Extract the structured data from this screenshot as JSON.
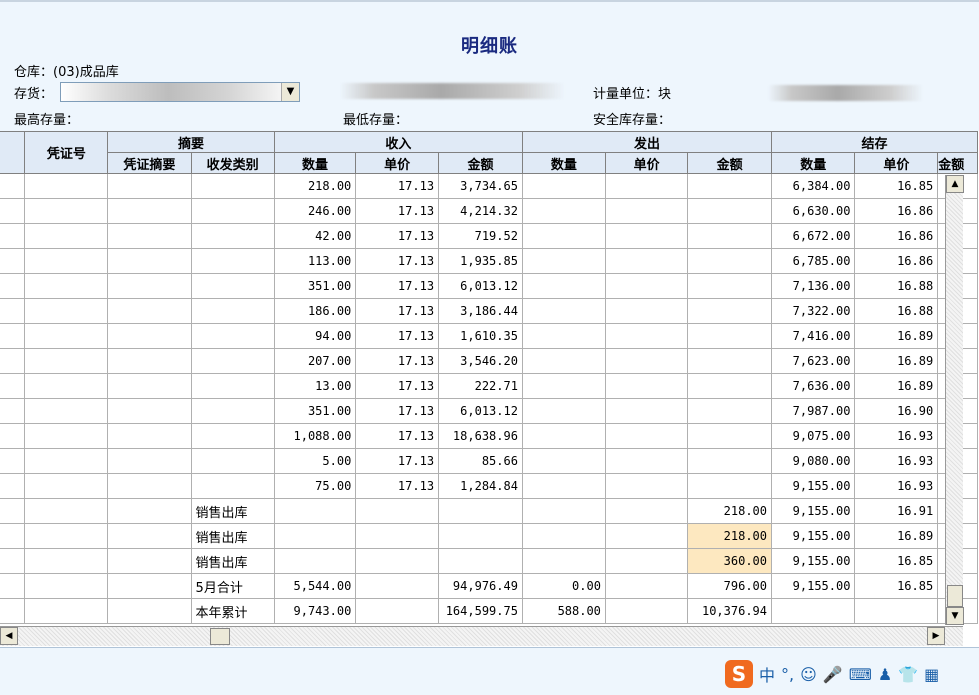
{
  "header": {
    "title": "明细账",
    "warehouse_label": "仓库：",
    "warehouse_value": "(03)成品库",
    "inventory_label": "存货：",
    "unit_label": "计量单位：",
    "unit_value": "块",
    "max_stock_label": "最高存量：",
    "min_stock_label": "最低存量：",
    "safety_stock_label": "安全库存量："
  },
  "columns": {
    "voucher_no": "凭证号",
    "summary": "摘要",
    "voucher_summary": "凭证摘要",
    "category": "收发类别",
    "income": "收入",
    "outgo": "发出",
    "balance": "结存",
    "qty": "数量",
    "price": "单价",
    "amount": "金额",
    "amount_cut": "金额"
  },
  "rows": [
    {
      "cat": "",
      "in_qty": "218.00",
      "in_price": "17.13",
      "in_amt": "3,734.65",
      "out_qty": "",
      "out_price": "",
      "out_amt": "",
      "bal_qty": "6,384.00",
      "bal_price": "16.85"
    },
    {
      "cat": "",
      "in_qty": "246.00",
      "in_price": "17.13",
      "in_amt": "4,214.32",
      "out_qty": "",
      "out_price": "",
      "out_amt": "",
      "bal_qty": "6,630.00",
      "bal_price": "16.86"
    },
    {
      "cat": "",
      "in_qty": "42.00",
      "in_price": "17.13",
      "in_amt": "719.52",
      "out_qty": "",
      "out_price": "",
      "out_amt": "",
      "bal_qty": "6,672.00",
      "bal_price": "16.86"
    },
    {
      "cat": "",
      "in_qty": "113.00",
      "in_price": "17.13",
      "in_amt": "1,935.85",
      "out_qty": "",
      "out_price": "",
      "out_amt": "",
      "bal_qty": "6,785.00",
      "bal_price": "16.86"
    },
    {
      "cat": "",
      "in_qty": "351.00",
      "in_price": "17.13",
      "in_amt": "6,013.12",
      "out_qty": "",
      "out_price": "",
      "out_amt": "",
      "bal_qty": "7,136.00",
      "bal_price": "16.88"
    },
    {
      "cat": "",
      "in_qty": "186.00",
      "in_price": "17.13",
      "in_amt": "3,186.44",
      "out_qty": "",
      "out_price": "",
      "out_amt": "",
      "bal_qty": "7,322.00",
      "bal_price": "16.88"
    },
    {
      "cat": "",
      "in_qty": "94.00",
      "in_price": "17.13",
      "in_amt": "1,610.35",
      "out_qty": "",
      "out_price": "",
      "out_amt": "",
      "bal_qty": "7,416.00",
      "bal_price": "16.89"
    },
    {
      "cat": "",
      "in_qty": "207.00",
      "in_price": "17.13",
      "in_amt": "3,546.20",
      "out_qty": "",
      "out_price": "",
      "out_amt": "",
      "bal_qty": "7,623.00",
      "bal_price": "16.89"
    },
    {
      "cat": "",
      "in_qty": "13.00",
      "in_price": "17.13",
      "in_amt": "222.71",
      "out_qty": "",
      "out_price": "",
      "out_amt": "",
      "bal_qty": "7,636.00",
      "bal_price": "16.89"
    },
    {
      "cat": "",
      "in_qty": "351.00",
      "in_price": "17.13",
      "in_amt": "6,013.12",
      "out_qty": "",
      "out_price": "",
      "out_amt": "",
      "bal_qty": "7,987.00",
      "bal_price": "16.90"
    },
    {
      "cat": "",
      "in_qty": "1,088.00",
      "in_price": "17.13",
      "in_amt": "18,638.96",
      "out_qty": "",
      "out_price": "",
      "out_amt": "",
      "bal_qty": "9,075.00",
      "bal_price": "16.93"
    },
    {
      "cat": "",
      "in_qty": "5.00",
      "in_price": "17.13",
      "in_amt": "85.66",
      "out_qty": "",
      "out_price": "",
      "out_amt": "",
      "bal_qty": "9,080.00",
      "bal_price": "16.93"
    },
    {
      "cat": "",
      "in_qty": "75.00",
      "in_price": "17.13",
      "in_amt": "1,284.84",
      "out_qty": "",
      "out_price": "",
      "out_amt": "",
      "bal_qty": "9,155.00",
      "bal_price": "16.93"
    },
    {
      "cat": "销售出库",
      "in_qty": "",
      "in_price": "",
      "in_amt": "",
      "out_qty": "",
      "out_price": "",
      "out_amt": "218.00",
      "bal_qty": "9,155.00",
      "bal_price": "16.91",
      "style": "sel"
    },
    {
      "cat": "销售出库",
      "in_qty": "",
      "in_price": "",
      "in_amt": "",
      "out_qty": "",
      "out_price": "",
      "out_amt": "218.00",
      "bal_qty": "9,155.00",
      "bal_price": "16.89",
      "style": "hl"
    },
    {
      "cat": "销售出库",
      "in_qty": "",
      "in_price": "",
      "in_amt": "",
      "out_qty": "",
      "out_price": "",
      "out_amt": "360.00",
      "bal_qty": "9,155.00",
      "bal_price": "16.85",
      "style": "hl"
    },
    {
      "cat": "5月合计",
      "in_qty": "5,544.00",
      "in_price": "",
      "in_amt": "94,976.49",
      "out_qty": "0.00",
      "out_price": "",
      "out_amt": "796.00",
      "bal_qty": "9,155.00",
      "bal_price": "16.85"
    },
    {
      "cat": "本年累计",
      "in_qty": "9,743.00",
      "in_price": "",
      "in_amt": "164,599.75",
      "out_qty": "588.00",
      "out_price": "",
      "out_amt": "10,376.94",
      "bal_qty": "",
      "bal_price": ""
    }
  ],
  "ime": {
    "logo": "S",
    "lang": "中",
    "punct": "°,",
    "emoji": "☺",
    "mic": "🎤",
    "keyboard": "⌨",
    "user": "♟",
    "shirt": "👕",
    "grid": "▦"
  },
  "scroll": {
    "up": "▲",
    "down": "▼",
    "left": "◀",
    "right": "▶"
  }
}
